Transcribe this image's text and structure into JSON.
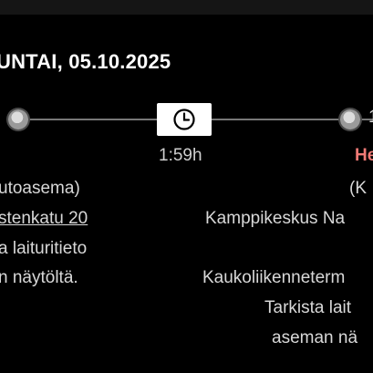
{
  "header": {
    "date": "UNTAI, 05.10.2025"
  },
  "timeline": {
    "duration": "1:59h",
    "right_node_text": "1"
  },
  "departure": {
    "station_type": "utoasema)",
    "street": "stenkatu 20",
    "platform_note_1": "a laituritieto",
    "platform_note_2": "n näytöltä."
  },
  "arrival": {
    "city": "He",
    "paren": "(K",
    "place": "Kamppikeskus Na",
    "terminal": "Kaukoliikenneterm",
    "check": "Tarkista lait",
    "station": "aseman nä"
  },
  "colors": {
    "accent_red": "#f07a76",
    "background": "#000000"
  }
}
